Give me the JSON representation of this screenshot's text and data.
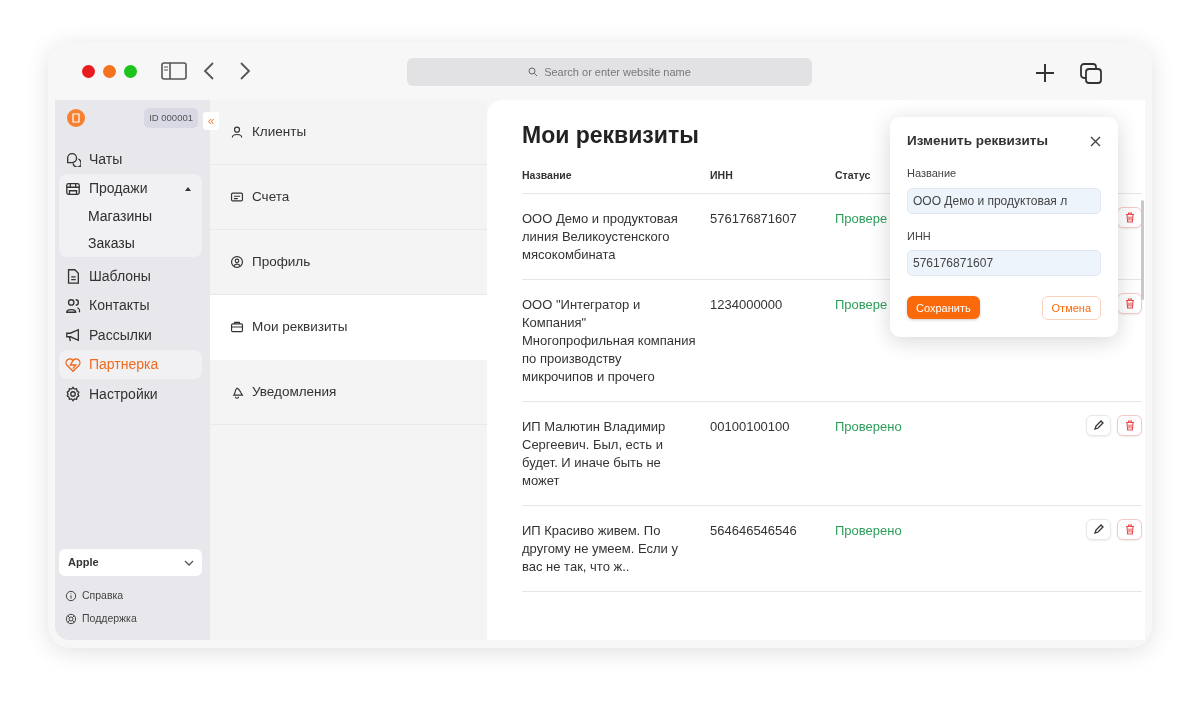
{
  "browser": {
    "address_placeholder": "Search or enter website name"
  },
  "sidebar": {
    "account_id": "ID 000001",
    "collapse": "«",
    "items": [
      {
        "label": "Чаты",
        "selected": false
      },
      {
        "label": "Продажи",
        "selected": false,
        "expanded": true,
        "children": [
          {
            "label": "Магазины",
            "selected": false
          },
          {
            "label": "Заказы",
            "selected": false
          }
        ]
      },
      {
        "label": "Шаблоны",
        "selected": false
      },
      {
        "label": "Контакты",
        "selected": false
      },
      {
        "label": "Рассылки",
        "selected": false
      },
      {
        "label": "Партнерка",
        "selected": true
      },
      {
        "label": "Настройки",
        "selected": false
      }
    ],
    "company_select": {
      "value": "Apple"
    },
    "help_links": [
      {
        "label": "Справка"
      },
      {
        "label": "Поддержка"
      }
    ]
  },
  "settings_menu": [
    {
      "label": "Клиенты",
      "selected": false
    },
    {
      "label": "Счета",
      "selected": false
    },
    {
      "label": "Профиль",
      "selected": false
    },
    {
      "label": "Мои реквизиты",
      "selected": true
    },
    {
      "label": "Уведомления",
      "selected": false
    }
  ],
  "page": {
    "title": "Мои реквизиты",
    "table": {
      "columns": [
        "Название",
        "ИНН",
        "Статус"
      ],
      "rows": [
        {
          "name": "ООО Демо и продуктовая линия Великоустенского мясокомбината",
          "inn": "576176871607",
          "status": "Провере",
          "edit_button": false
        },
        {
          "name": "ООО \"Интегратор и Компания\" Многопрофильная компания по производству микрочипов и прочего",
          "inn": "1234000000",
          "status": "Провере",
          "edit_button": false
        },
        {
          "name": "ИП Малютин Владимир Сергеевич. Был, есть и будет. И иначе быть не может",
          "inn": "00100100100",
          "status": "Проверено",
          "edit_button": true
        },
        {
          "name": "ИП Красиво живем. По другому не умеем. Если у вас не так, что ж..",
          "inn": "564646546546",
          "status": "Проверено",
          "edit_button": true
        }
      ]
    }
  },
  "dialog": {
    "title": "Изменить реквизиты",
    "fields": [
      {
        "label": "Название",
        "value": "ООО Демо и продуктовая л"
      },
      {
        "label": "ИНН",
        "value": "576176871607"
      }
    ],
    "buttons": [
      {
        "label": "Сохранить",
        "kind": "primary"
      },
      {
        "label": "Отмена",
        "kind": "secondary"
      }
    ]
  }
}
